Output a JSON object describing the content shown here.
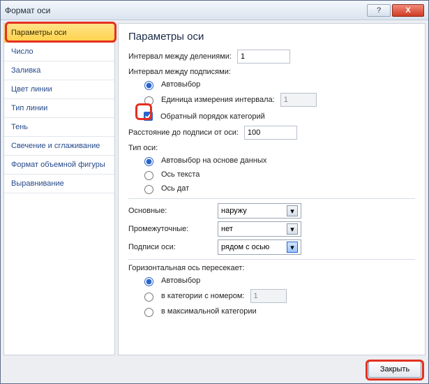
{
  "window": {
    "title": "Формат оси",
    "help_tip": "?",
    "close_tip": "X"
  },
  "sidebar": {
    "items": [
      {
        "label": "Параметры оси",
        "selected": true
      },
      {
        "label": "Число"
      },
      {
        "label": "Заливка"
      },
      {
        "label": "Цвет линии"
      },
      {
        "label": "Тип линии"
      },
      {
        "label": "Тень"
      },
      {
        "label": "Свечение и сглаживание"
      },
      {
        "label": "Формат объемной фигуры"
      },
      {
        "label": "Выравнивание"
      }
    ]
  },
  "panel": {
    "heading": "Параметры оси",
    "interval_ticks_label": "Интервал между делениями:",
    "interval_ticks_value": "1",
    "interval_labels_label": "Интервал между подписями:",
    "radio_auto_label": "Автовыбор",
    "radio_unit_label": "Единица измерения интервала:",
    "radio_unit_value": "1",
    "reverse_checkbox_label": "Обратный порядок категорий",
    "reverse_checked": true,
    "distance_label": "Расстояние до подписи от оси:",
    "distance_value": "100",
    "axis_type_label": "Тип оси:",
    "axis_type_auto": "Автовыбор на основе данных",
    "axis_type_text": "Ось текста",
    "axis_type_date": "Ось дат",
    "major_label": "Основные:",
    "major_value": "наружу",
    "minor_label": "Промежуточные:",
    "minor_value": "нет",
    "labels_label": "Подписи оси:",
    "labels_value": "рядом с осью",
    "cross_label": "Горизонтальная ось пересекает:",
    "cross_auto": "Автовыбор",
    "cross_cat_label": "в категории с номером:",
    "cross_cat_value": "1",
    "cross_max": "в максимальной категории"
  },
  "footer": {
    "close_label": "Закрыть"
  }
}
